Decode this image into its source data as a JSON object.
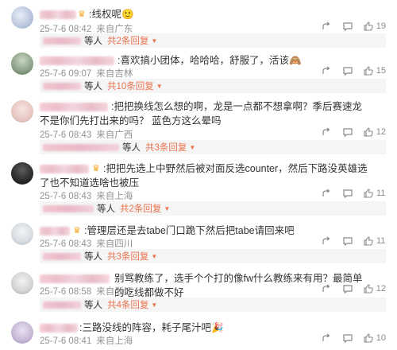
{
  "comments": [
    {
      "text": ":线权呢🙂",
      "date": "25-7-6 08:42",
      "location": "来自广东",
      "likes": "19",
      "reply_who": "等人",
      "reply_count": "共2条回复"
    },
    {
      "text": ":喜欢搞小团体，哈哈哈，舒服了，活该🙈",
      "date": "25-7-6 09:07",
      "location": "来自吉林",
      "likes": "15",
      "reply_who": "等人",
      "reply_count": "共10条回复"
    },
    {
      "text": ":把把换线怎么想的啊，龙是一点都不想拿啊？季后赛速龙不是你们先打出来的吗？ 蓝色方这么晕吗",
      "date": "25-7-6 08:43",
      "location": "来自广西",
      "likes": "12",
      "reply_who": "等人",
      "reply_count": "共3条回复"
    },
    {
      "text": ":把把先选上中野然后被对面反选counter，然后下路没英雄选了也不知道选啥也被压",
      "date": "25-7-6 08:43",
      "location": "来自上海",
      "likes": "11",
      "reply_who": "等人",
      "reply_count": "共2条回复"
    },
    {
      "text": ":管理层还是去tabe门口跪下然后把tabe请回来吧",
      "date": "25-7-6 08:43",
      "location": "来自四川",
      "likes": "11",
      "reply_who": "等人",
      "reply_count": "共3条回复"
    },
    {
      "text": "别骂教练了，选手个个打的像fw什么教练来有用？最简单的吃线都做不好",
      "date": "25-7-6 08:58",
      "location": "来自浙江",
      "likes": "12",
      "reply_who": "等人",
      "reply_count": "共4条回复"
    },
    {
      "text": ":三路没线的阵容，耗子尾汁吧🎉",
      "date": "25-7-6 08:41",
      "location": "来自上海",
      "likes": "10",
      "reply_who": "",
      "reply_count": ""
    }
  ],
  "icons": {
    "share": "share-icon",
    "comment": "comment-icon",
    "like": "thumbs-up-icon",
    "crown": "crown-icon"
  },
  "colors": {
    "accent": "#eb7350",
    "meta": "#939393",
    "reply_bg": "#f5f5f5"
  }
}
